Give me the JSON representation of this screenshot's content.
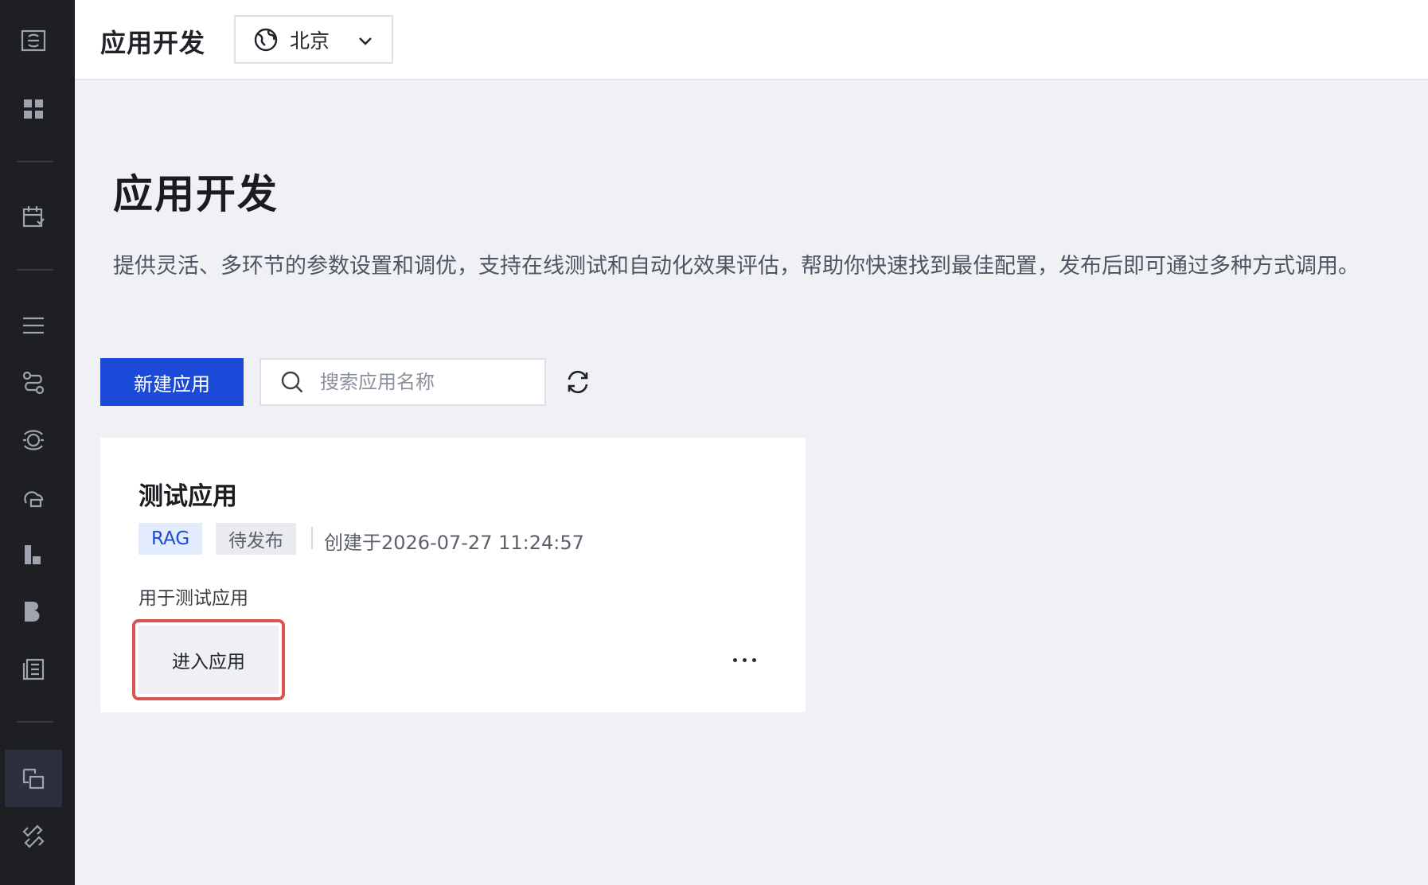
{
  "header": {
    "title": "应用开发",
    "region": {
      "selected": "北京"
    }
  },
  "main": {
    "title": "应用开发",
    "description": "提供灵活、多环节的参数设置和调优，支持在线测试和自动化效果评估，帮助你快速找到最佳配置，发布后即可通过多种方式调用。",
    "toolbar": {
      "new_button": "新建应用",
      "search_placeholder": "搜索应用名称",
      "search_value": ""
    },
    "apps": [
      {
        "name": "测试应用",
        "type_tag": "RAG",
        "status": "待发布",
        "created": "创建于2026-07-27 11:24:57",
        "description": "用于测试应用",
        "enter_button": "进入应用"
      }
    ]
  },
  "sidebar": {
    "icons": [
      "app-logo-icon",
      "dashboard-icon",
      "calendar-icon",
      "list-icon",
      "flow-icon",
      "model-icon",
      "cloud-sync-icon",
      "chart-icon",
      "database-icon",
      "book-icon",
      "app-dev-icon",
      "link-icon"
    ],
    "active": "app-dev-icon"
  },
  "colors": {
    "primary": "#1c4ad8",
    "sidebar_bg": "#1e1f22",
    "highlight": "#d9534f"
  }
}
